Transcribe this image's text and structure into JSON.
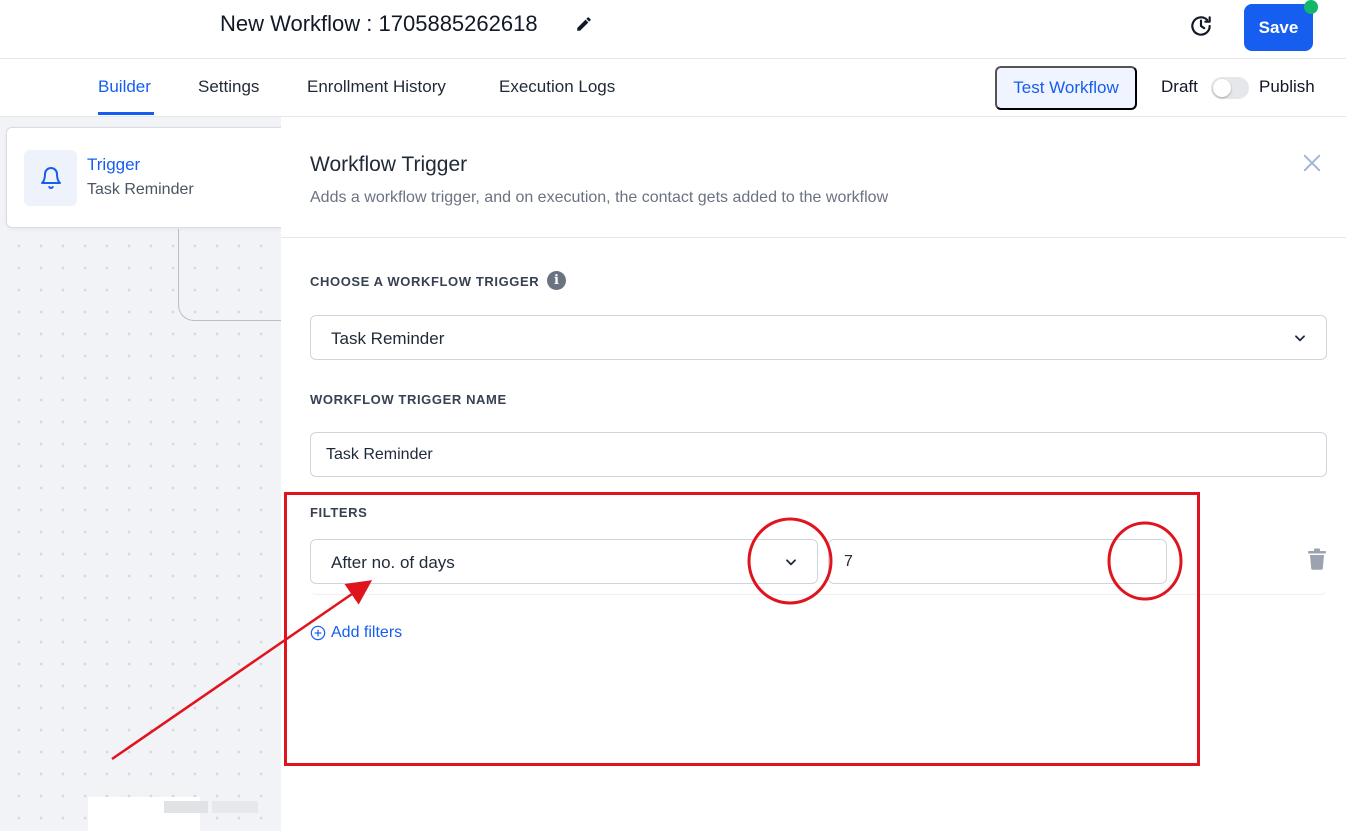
{
  "header": {
    "workflow_title": "New Workflow : 1705885262618",
    "save_label": "Save",
    "status_color": "#12b76a",
    "accent_color": "#155eef"
  },
  "tabs": {
    "items": [
      {
        "label": "Builder",
        "active": true
      },
      {
        "label": "Settings",
        "active": false
      },
      {
        "label": "Enrollment History",
        "active": false
      },
      {
        "label": "Execution Logs",
        "active": false
      }
    ],
    "test_workflow_label": "Test Workflow",
    "draft_label": "Draft",
    "publish_label": "Publish",
    "publish_toggle_on": false
  },
  "canvas": {
    "trigger_card": {
      "title": "Trigger",
      "subtitle": "Task Reminder",
      "icon": "bell-icon"
    }
  },
  "panel": {
    "title": "Workflow Trigger",
    "description": "Adds a workflow trigger, and on execution, the contact gets added to the workflow",
    "choose_trigger_label": "CHOOSE A WORKFLOW TRIGGER",
    "choose_trigger_value": "Task Reminder",
    "trigger_name_label": "WORKFLOW TRIGGER NAME",
    "trigger_name_value": "Task Reminder",
    "filters_label": "FILTERS",
    "filter": {
      "field": "After no. of days",
      "value": "7"
    },
    "add_filters_label": "Add filters"
  },
  "annotations": {
    "color": "#e0141e",
    "shapes": [
      "rectangle",
      "circle",
      "circle",
      "arrow"
    ]
  }
}
